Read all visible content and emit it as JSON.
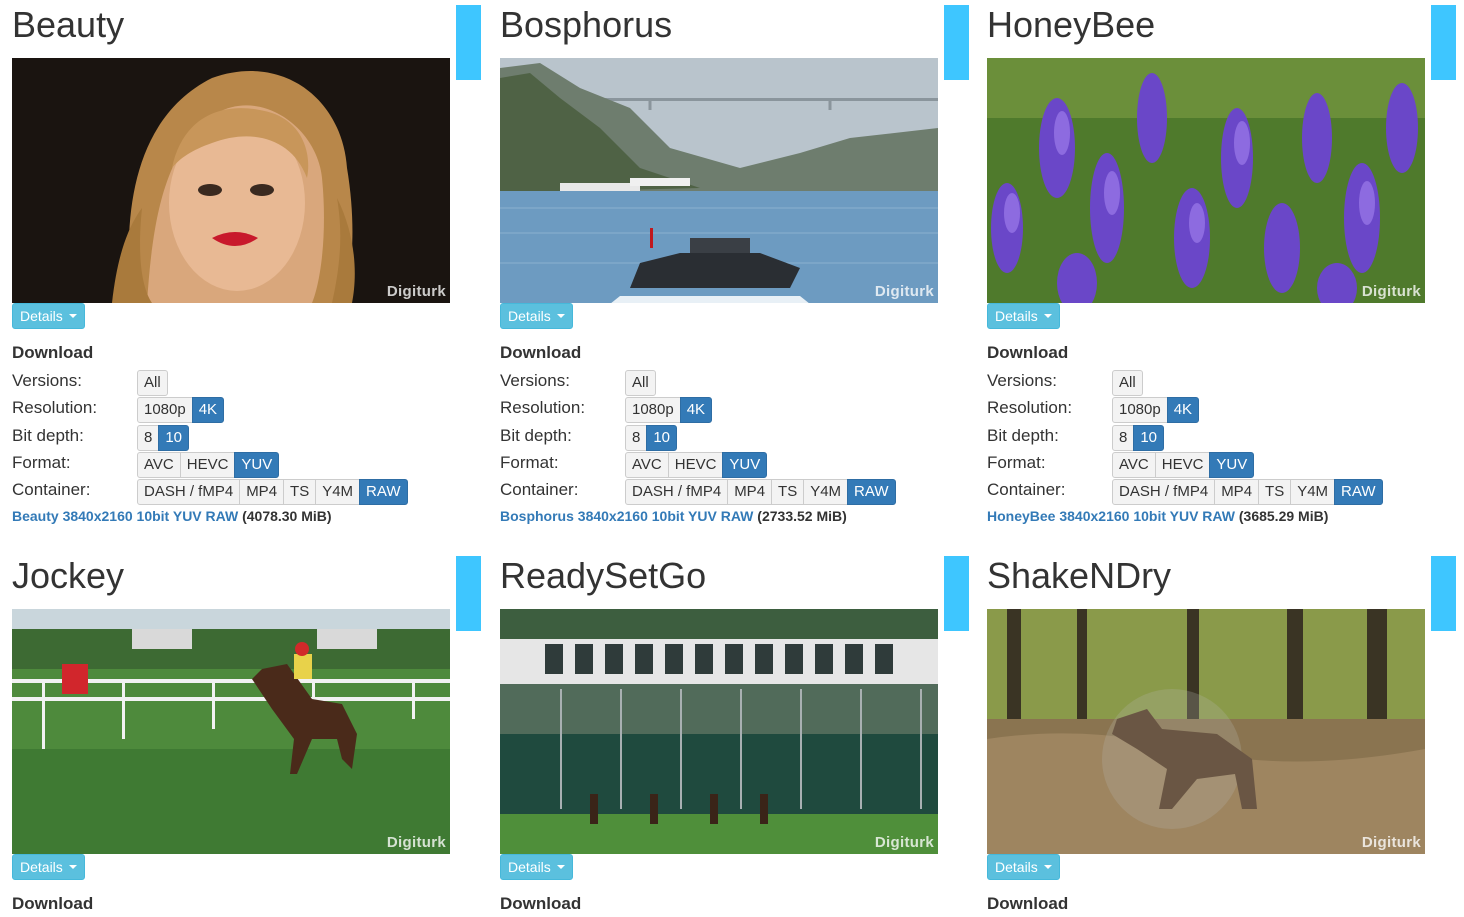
{
  "labels": {
    "details": "Details",
    "download": "Download",
    "versions": "Versions:",
    "resolution": "Resolution:",
    "bit_depth": "Bit depth:",
    "format": "Format:",
    "container": "Container:"
  },
  "watermark": "Digiturk",
  "options": {
    "versions": [
      "All"
    ],
    "resolution": [
      "1080p",
      "4K"
    ],
    "bit_depth": [
      "8",
      "10"
    ],
    "format": [
      "AVC",
      "HEVC",
      "YUV"
    ],
    "container": [
      "DASH / fMP4",
      "MP4",
      "TS",
      "Y4M",
      "RAW"
    ]
  },
  "selected": {
    "resolution": "4K",
    "bit_depth": "10",
    "format": "YUV",
    "container": "RAW"
  },
  "videos": [
    {
      "title": "Beauty",
      "file_link": "Beauty 3840x2160 10bit YUV RAW",
      "file_size": "(4078.30 MiB)"
    },
    {
      "title": "Bosphorus",
      "file_link": "Bosphorus 3840x2160 10bit YUV RAW",
      "file_size": "(2733.52 MiB)"
    },
    {
      "title": "HoneyBee",
      "file_link": "HoneyBee 3840x2160 10bit YUV RAW",
      "file_size": "(3685.29 MiB)"
    },
    {
      "title": "Jockey"
    },
    {
      "title": "ReadySetGo"
    },
    {
      "title": "ShakeNDry"
    }
  ],
  "colors": {
    "accent": "#3ec6ff",
    "details_button": "#5bc0de",
    "active_option": "#337ab7",
    "link": "#337ab7"
  }
}
